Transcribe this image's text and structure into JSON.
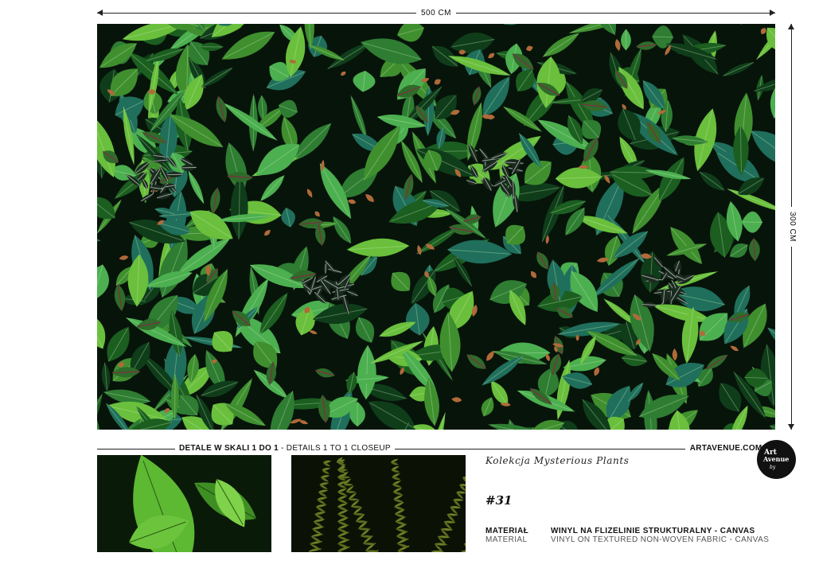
{
  "dimensions": {
    "width_label": "500 CM",
    "height_label": "300 CM"
  },
  "details": {
    "label_pl": "DETALE W SKALI 1 DO 1",
    "label_en": " - DETAILS 1 TO 1 CLOSEUP",
    "website": "ARTAVENUE.COM.PL"
  },
  "logo": {
    "line1": "Art",
    "line2": "Avenue",
    "line3": "by"
  },
  "product": {
    "collection": "Kolekcja Mysterious Plants",
    "number": "#31"
  },
  "material": {
    "label_pl": "MATERIAŁ",
    "label_en": "MATERIAL",
    "value_pl": "WINYL NA FLIZELINIE STRUKTURALNY - CANVAS",
    "value_en": "VINYL ON TEXTURED NON-WOVEN FABRIC - CANVAS"
  },
  "colors": {
    "leaf_dark": "#0f3d1a",
    "leaf_mid": "#2e7d32",
    "leaf_light": "#6abf3c",
    "teal": "#1f6f5c",
    "orchid": "#b06a3a",
    "caladium": "#8e2448",
    "succulent": "#9aa59c"
  }
}
